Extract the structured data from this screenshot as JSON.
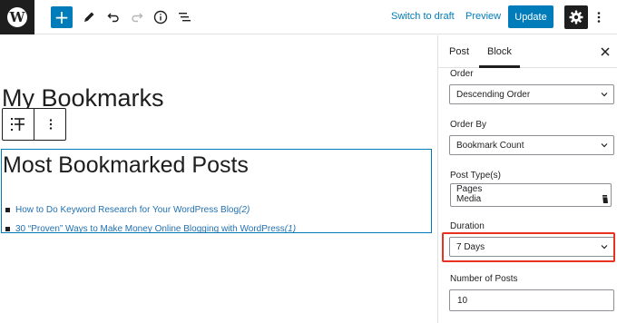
{
  "toolbar": {
    "logo_glyph": "W",
    "add_glyph": "+",
    "switch_to_draft": "Switch to draft",
    "preview": "Preview",
    "update": "Update",
    "icons": [
      "plus-icon",
      "pencil-icon",
      "undo-icon",
      "redo-icon",
      "info-icon",
      "list-view-icon",
      "gear-icon",
      "more-vertical-icon"
    ]
  },
  "editor": {
    "page_title": "My Bookmarks",
    "block_heading": "Most Bookmarked Posts",
    "posts": [
      {
        "title": "How to Do Keyword Research for Your WordPress Blog",
        "count": "(2)"
      },
      {
        "title": "30 “Proven” Ways to Make Money Online Blogging with WordPress",
        "count": "(1)"
      }
    ]
  },
  "sidebar": {
    "tabs": [
      "Post",
      "Block"
    ],
    "active_tab": "Block",
    "order_label": "Order",
    "order_value": "Descending Order",
    "order_by_label": "Order By",
    "order_by_value": "Bookmark Count",
    "post_types_label": "Post Type(s)",
    "post_types_options": [
      "Pages",
      "Media"
    ],
    "duration_label": "Duration",
    "duration_value": "7 Days",
    "number_label": "Number of Posts",
    "number_value": "10"
  },
  "colors": {
    "accent": "#007cba",
    "link": "#2271b1",
    "dark": "#1e1e1e",
    "highlight": "#e8311f"
  }
}
